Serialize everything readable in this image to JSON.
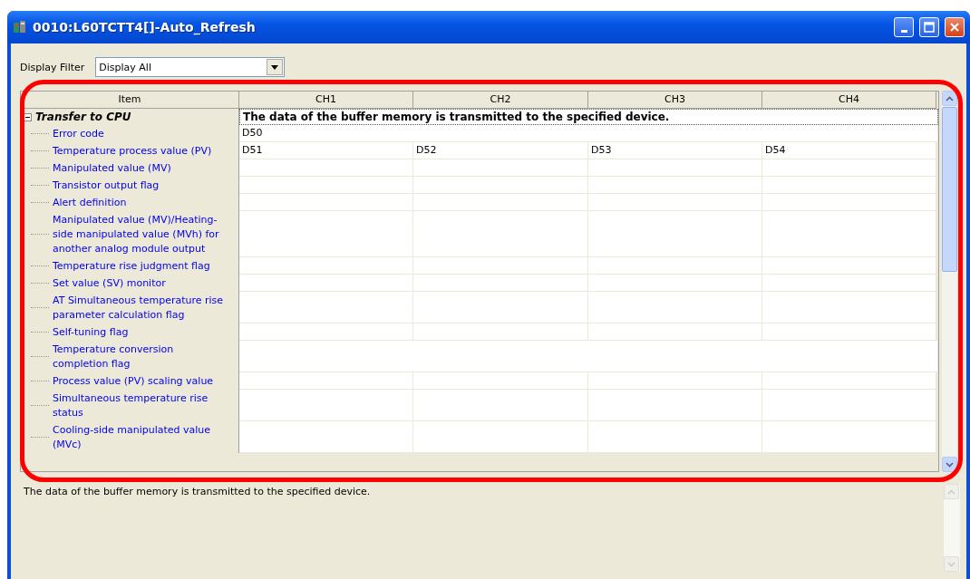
{
  "window": {
    "title": "0010:L60TCTT4[]-Auto_Refresh"
  },
  "display_filter": {
    "label": "Display Filter",
    "value": "Display All"
  },
  "table": {
    "columns": [
      "Item",
      "CH1",
      "CH2",
      "CH3",
      "CH4"
    ],
    "groups": [
      {
        "label": "Transfer to CPU",
        "expanded": true,
        "selected": true,
        "text": "The data of the buffer memory is transmitted to the specified device.",
        "children": [
          {
            "label": "Error code",
            "kind": "whole",
            "cells": [
              "D50"
            ]
          },
          {
            "label": "Temperature process value (PV)",
            "kind": "channels",
            "cells": [
              "D51",
              "D52",
              "D53",
              "D54"
            ]
          },
          {
            "label": "Manipulated value (MV)",
            "kind": "channels"
          },
          {
            "label": "Transistor output flag",
            "kind": "channels"
          },
          {
            "label": "Alert definition",
            "kind": "channels"
          },
          {
            "label": "Manipulated value (MV)/Heating-side manipulated value (MVh) for another analog module output",
            "kind": "channels"
          },
          {
            "label": "Temperature rise judgment flag",
            "kind": "channels"
          },
          {
            "label": "Set value (SV) monitor",
            "kind": "channels"
          },
          {
            "label": "AT Simultaneous temperature rise parameter calculation flag",
            "kind": "channels"
          },
          {
            "label": "Self-tuning flag",
            "kind": "channels"
          },
          {
            "label": "Temperature conversion completion flag",
            "kind": "whole"
          },
          {
            "label": "Process value (PV) scaling value",
            "kind": "channels"
          },
          {
            "label": "Simultaneous temperature rise status",
            "kind": "channels"
          },
          {
            "label": "Cooling-side manipulated value (MVc)",
            "kind": "channels"
          }
        ]
      }
    ]
  },
  "description": "The data of the buffer memory is transmitted to the specified device."
}
